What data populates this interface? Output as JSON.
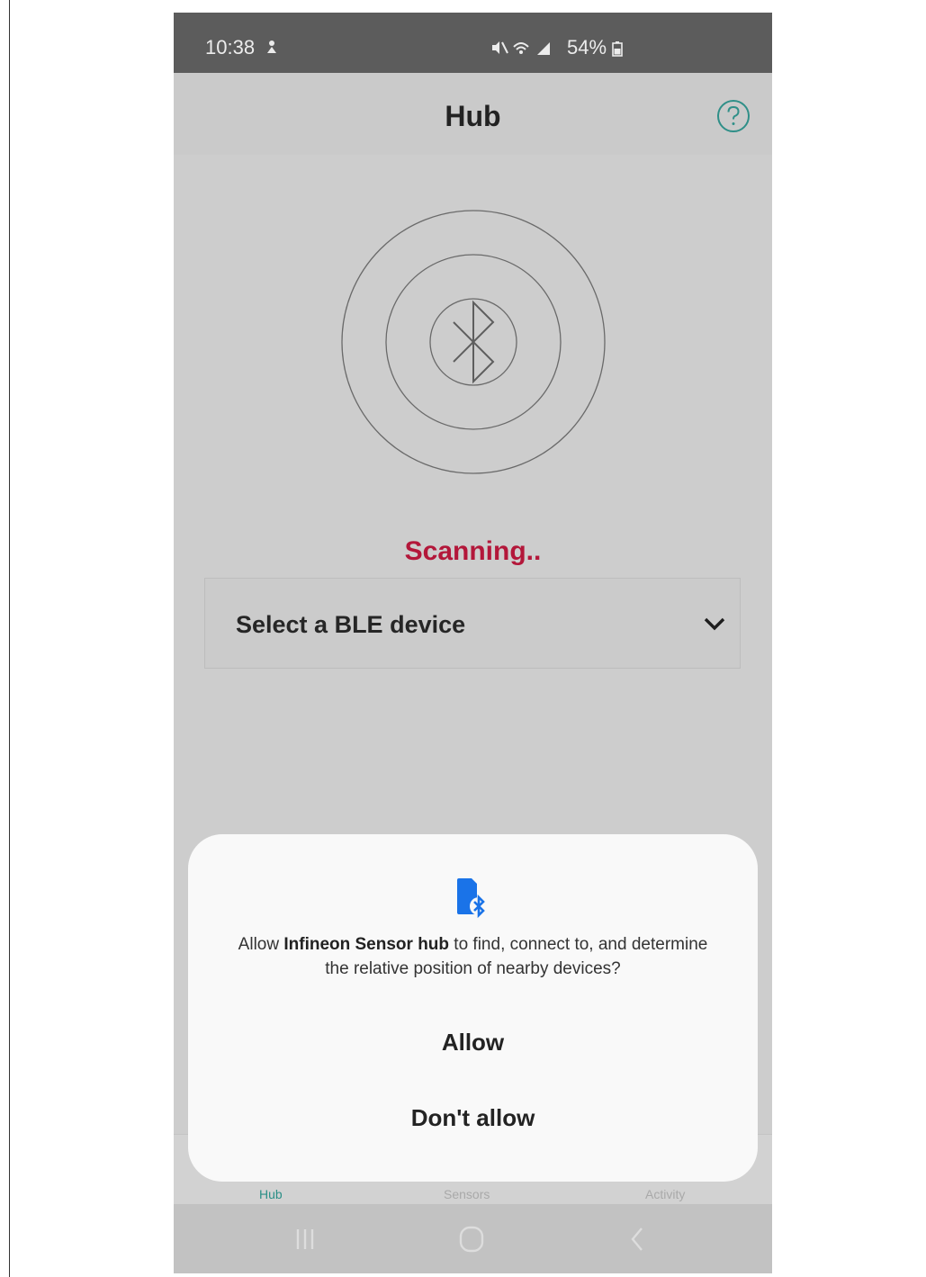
{
  "status_bar": {
    "time": "10:38",
    "battery": "54%"
  },
  "app_bar": {
    "title": "Hub",
    "help_icon": "question-circle-icon"
  },
  "main": {
    "scan_status": "Scanning..",
    "scan_status_color": "#b3173a",
    "device_select": {
      "selected_value": "Select a BLE device"
    }
  },
  "permission_dialog": {
    "text_prefix": "Allow ",
    "app_name": "Infineon Sensor hub",
    "text_suffix": " to find, connect to, and determine the relative position of nearby devices?",
    "allow_label": "Allow",
    "deny_label": "Don't allow",
    "icon": "nearby-devices-bluetooth-icon",
    "accent_color": "#1a73e8"
  },
  "bottom_nav": {
    "items": [
      {
        "label": "Hub"
      },
      {
        "label": "Sensors"
      },
      {
        "label": "Activity"
      }
    ],
    "active_color": "#2b8f87"
  }
}
